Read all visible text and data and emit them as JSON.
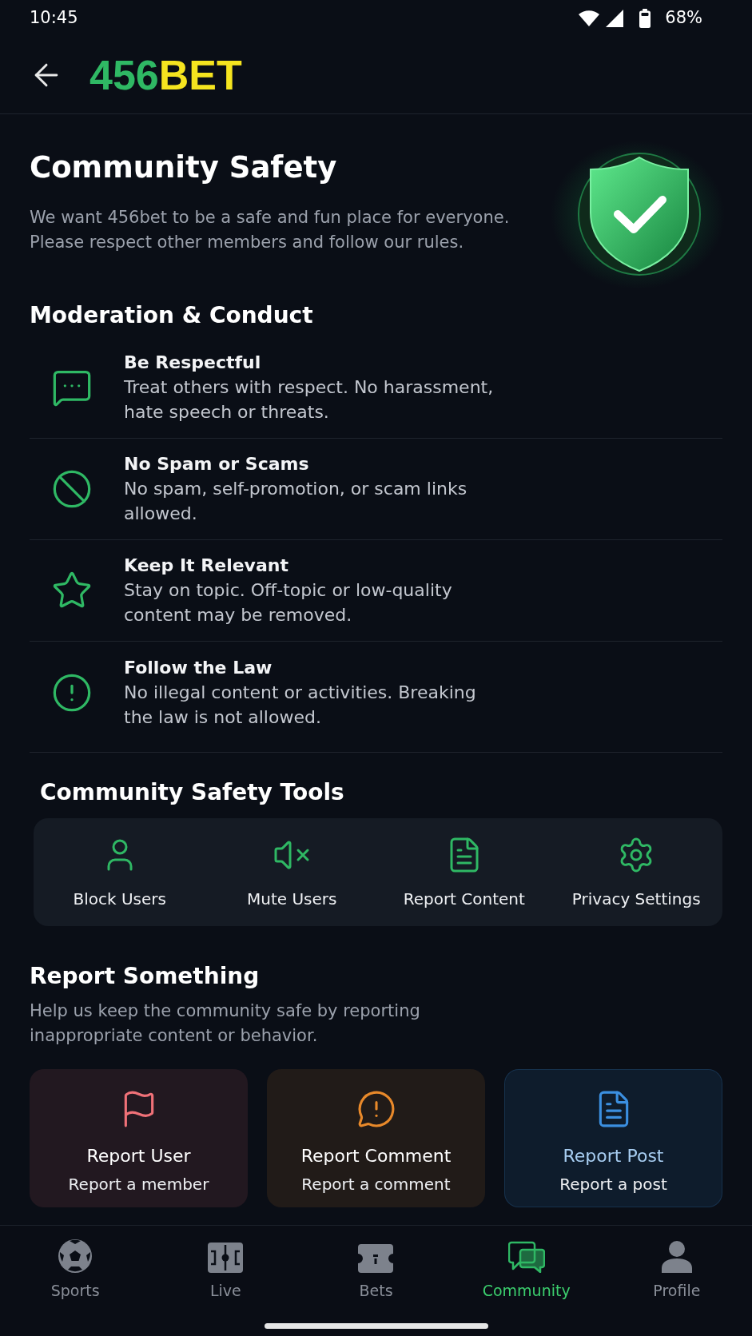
{
  "status_bar": {
    "time": "10:45",
    "battery": "68%"
  },
  "header": {
    "logo": [
      "456",
      "BET"
    ]
  },
  "hero": {
    "title": "Community Safety",
    "description": "We want 456bet to be a safe and fun place for everyone. Please respect other members and follow our rules."
  },
  "moderation": {
    "title": "Moderation & Conduct",
    "rules": [
      {
        "title": "Be Respectful",
        "description": "Treat others with respect. No harassment, hate speech or threats."
      },
      {
        "title": "No Spam or Scams",
        "description": "No spam, self-promotion, or scam links allowed."
      },
      {
        "title": "Keep It Relevant",
        "description": "Stay on topic. Off-topic or low-quality content may be removed."
      },
      {
        "title": "Follow the Law",
        "description": "No illegal content or activities. Breaking the law is not allowed."
      }
    ]
  },
  "tools": {
    "title": "Community Safety Tools",
    "items": [
      "Block Users",
      "Mute Users",
      "Report Content",
      "Privacy Settings"
    ]
  },
  "report": {
    "title": "Report Something",
    "description": "Help us keep the community safe by reporting inappropriate content or behavior.",
    "cards": [
      {
        "title": "Report User",
        "subtitle": "Report a member",
        "color": "#f07178",
        "highlighted": false
      },
      {
        "title": "Report Comment",
        "subtitle": "Report a comment",
        "color": "#e8892a",
        "highlighted": false
      },
      {
        "title": "Report Post",
        "subtitle": "Report a post",
        "color": "#3b8fe0",
        "highlighted": true
      }
    ]
  },
  "bottom_nav": {
    "items": [
      {
        "label": "Sports",
        "selected": false
      },
      {
        "label": "Live",
        "selected": false
      },
      {
        "label": "Bets",
        "selected": false
      },
      {
        "label": "Community",
        "selected": true
      },
      {
        "label": "Profile",
        "selected": false
      }
    ]
  }
}
